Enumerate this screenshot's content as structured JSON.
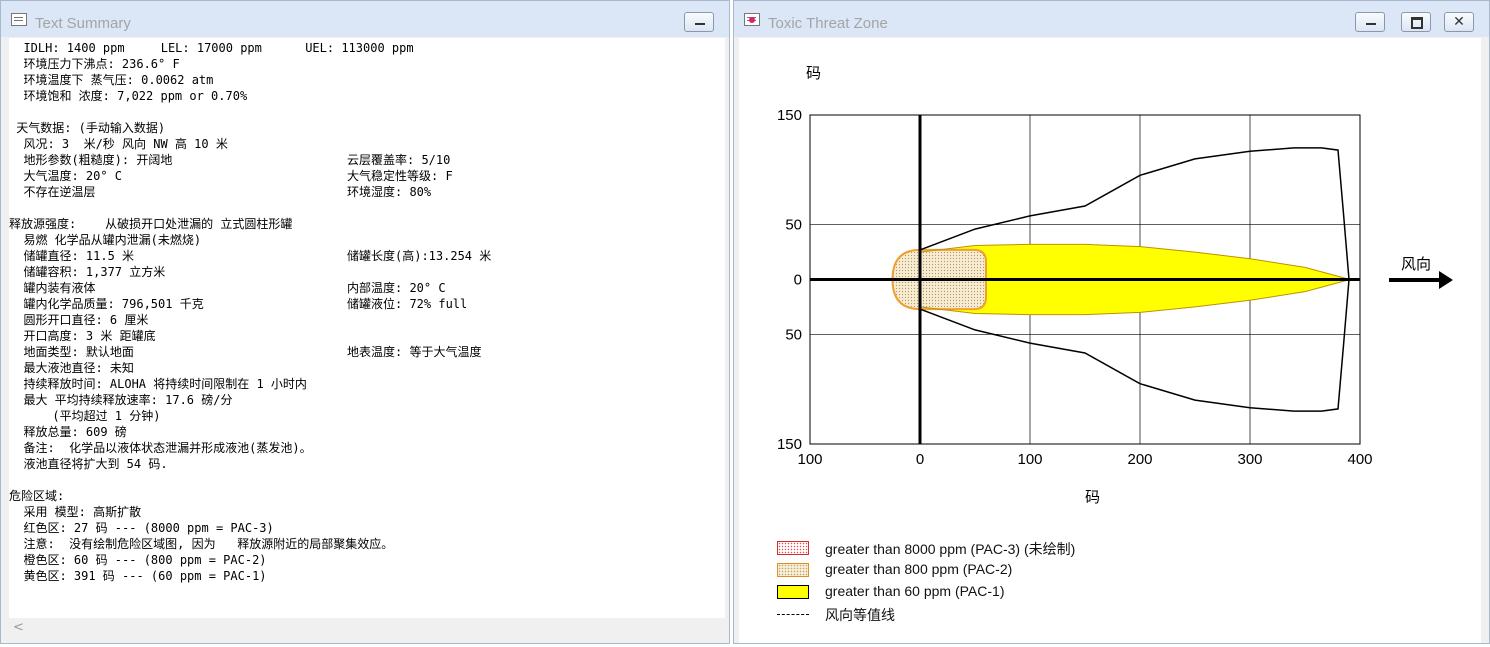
{
  "text_window": {
    "title": "Text Summary",
    "lines": [
      {
        "a": "  IDLH: 1400 ppm     LEL: 17000 ppm      UEL: 113000 ppm",
        "b": ""
      },
      {
        "a": "  环境压力下沸点: 236.6° F",
        "b": ""
      },
      {
        "a": "  环境温度下 蒸气压: 0.0062 atm",
        "b": ""
      },
      {
        "a": "  环境饱和 浓度: 7,022 ppm or 0.70%",
        "b": ""
      },
      {
        "a": "",
        "b": ""
      },
      {
        "a": " 天气数据: (手动输入数据)",
        "b": ""
      },
      {
        "a": "  风况: 3  米/秒 风向 NW 高 10 米",
        "b": ""
      },
      {
        "a": "  地形参数(粗糙度): 开阔地",
        "b": "云层覆盖率:  5/10"
      },
      {
        "a": "  大气温度: 20° C",
        "b": "大气稳定性等级: F"
      },
      {
        "a": "  不存在逆温层",
        "b": "环境湿度: 80%"
      },
      {
        "a": "",
        "b": ""
      },
      {
        "a": "释放源强度:    从破损开口处泄漏的 立式圆柱形罐",
        "b": ""
      },
      {
        "a": "  易燃 化学品从罐内泄漏(未燃烧)",
        "b": ""
      },
      {
        "a": "  储罐直径: 11.5 米",
        "b": "储罐长度(高):13.254 米"
      },
      {
        "a": "  储罐容积: 1,377 立方米",
        "b": ""
      },
      {
        "a": "  罐内装有液体",
        "b": "内部温度: 20° C"
      },
      {
        "a": "  罐内化学品质量: 796,501 千克",
        "b": "储罐液位: 72% full"
      },
      {
        "a": "  圆形开口直径: 6 厘米",
        "b": ""
      },
      {
        "a": "  开口高度: 3 米 距罐底",
        "b": ""
      },
      {
        "a": "  地面类型: 默认地面",
        "b": "地表温度: 等于大气温度"
      },
      {
        "a": "  最大液池直径: 未知",
        "b": ""
      },
      {
        "a": "  持续释放时间: ALOHA 将持续时间限制在 1 小时内",
        "b": ""
      },
      {
        "a": "  最大 平均持续释放速率: 17.6 磅/分",
        "b": ""
      },
      {
        "a": "      (平均超过 1 分钟)",
        "b": ""
      },
      {
        "a": "  释放总量: 609 磅",
        "b": ""
      },
      {
        "a": "  备注:  化学品以液体状态泄漏并形成液池(蒸发池)。",
        "b": ""
      },
      {
        "a": "  液池直径将扩大到 54 码.",
        "b": ""
      },
      {
        "a": "",
        "b": ""
      },
      {
        "a": "危险区域:",
        "b": ""
      },
      {
        "a": "  采用 模型: 高斯扩散",
        "b": ""
      },
      {
        "a": "  红色区: 27 码 --- (8000 ppm = PAC-3)",
        "b": ""
      },
      {
        "a": "  注意:  没有绘制危险区域图, 因为   释放源附近的局部聚集效应。",
        "b": ""
      },
      {
        "a": "  橙色区: 60 码 --- (800 ppm = PAC-2)",
        "b": ""
      },
      {
        "a": "  黄色区: 391 码 --- (60 ppm = PAC-1)",
        "b": ""
      }
    ],
    "scroll_arrow": "<"
  },
  "zone_window": {
    "title": "Toxic Threat Zone",
    "close_glyph": "✕",
    "wind_label": "风向",
    "legend": [
      {
        "label": "greater than 8000 ppm (PAC-3) (未绘制)",
        "style": "dotted-red"
      },
      {
        "label": "greater than 800 ppm (PAC-2)",
        "style": "dotted-orange"
      },
      {
        "label": "greater than 60 ppm (PAC-1)",
        "style": "yellow"
      },
      {
        "label": "风向等值线",
        "style": "dash"
      }
    ]
  },
  "chart_data": {
    "type": "area",
    "title": "",
    "xlabel": "码",
    "ylabel": "码",
    "xlim": [
      -100,
      400
    ],
    "ylim": [
      -150,
      150
    ],
    "x_ticks": [
      -100,
      0,
      100,
      200,
      300,
      400
    ],
    "x_tick_labels": [
      "100",
      "0",
      "100",
      "200",
      "300",
      "400"
    ],
    "y_ticks": [
      150,
      50,
      0,
      -50,
      -150
    ],
    "y_tick_labels": [
      "150",
      "50",
      "0",
      "50",
      "150"
    ],
    "grid": true,
    "colors": {
      "yellow": "#ffff00",
      "orange": "#f0a030",
      "pac2_fill": "#f5ecd2",
      "pac3_edge": "#d03030"
    },
    "series": [
      {
        "name": "greater than 60 ppm (PAC-1)",
        "kind": "yellow-zone",
        "x": [
          -25,
          0,
          50,
          100,
          150,
          200,
          250,
          300,
          350,
          391
        ],
        "y": [
          0,
          25,
          31,
          32,
          32,
          30,
          25,
          19,
          11,
          0
        ]
      },
      {
        "name": "greater than 800 ppm (PAC-2)",
        "kind": "orange-zone",
        "x": [
          -25,
          0,
          50,
          60
        ],
        "y": [
          0,
          27,
          27,
          20
        ]
      },
      {
        "name": "风向等值线",
        "kind": "confidence-line",
        "x": [
          0,
          50,
          100,
          150,
          200,
          250,
          300,
          340,
          365,
          380,
          385,
          390
        ],
        "y": [
          27,
          46,
          58,
          67,
          95,
          110,
          117,
          120,
          120,
          118,
          60,
          0
        ]
      }
    ]
  }
}
